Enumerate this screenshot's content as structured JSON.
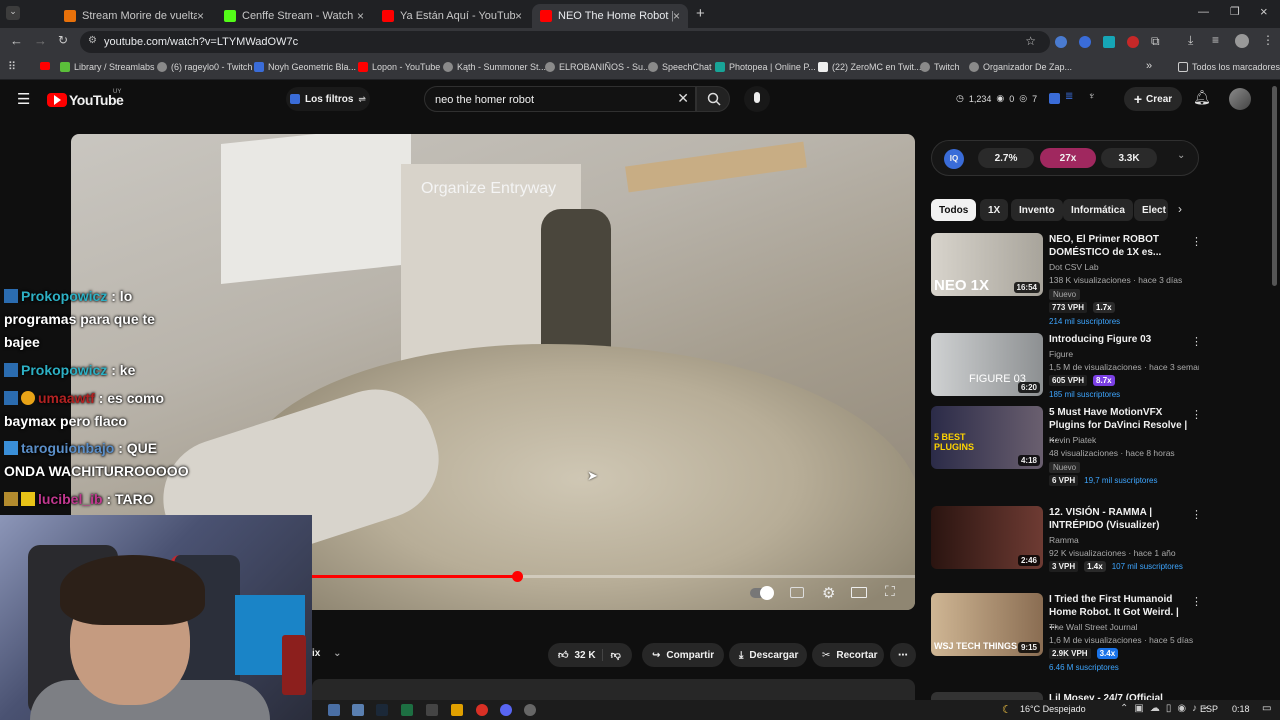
{
  "browser": {
    "tabs": [
      {
        "title": "Stream Morire de vuelta - Cenfe",
        "color": "#e8710a",
        "active": false
      },
      {
        "title": "Cenffe Stream - Watch Live on",
        "color": "#53fc18",
        "active": false
      },
      {
        "title": "Ya Están Aquí - YouTube",
        "color": "#ff0000",
        "active": false
      },
      {
        "title": "NEO The Home Robot | Or",
        "color": "#ff0000",
        "active": true
      }
    ],
    "url": "youtube.com/watch?v=LTYMWadOW7c",
    "bookmarks": [
      "Library / Streamlabs",
      "(6) rageylo0 - Twitch",
      "Noyh Geometric Bla...",
      "Lopon - YouTube",
      "Kąth - Summoner St...",
      "ELROBANIÑOS - Su...",
      "SpeechChat",
      "Photopea | Online P...",
      "(22) ZeroMC en Twit...",
      "Twitch",
      "Organizador De Zap..."
    ],
    "all_bookmarks": "Todos los marcadores"
  },
  "youtube": {
    "logo_text": "YouTube",
    "region": "UY",
    "filters_label": "Los filtros",
    "search_value": "neo the homer robot",
    "header_stats": {
      "views": "1,234",
      "a": "0",
      "b": "7"
    },
    "create_label": "Crear"
  },
  "video": {
    "caption": "Organize Entryway",
    "progress": 0.34
  },
  "actions": {
    "likes": "32 K",
    "share": "Compartir",
    "download": "Descargar",
    "clip": "Recortar",
    "partial": "ix"
  },
  "chat": [
    {
      "user": "Prokopowicz",
      "text": ": lo",
      "cont": "programas para que te",
      "cont2": "bajee",
      "color": "#2db0c4"
    },
    {
      "user": "Prokopowicz",
      "text": ": ke",
      "color": "#2db0c4"
    },
    {
      "user": "umaawtf",
      "text": ": es como",
      "cont": "baymax pero flaco",
      "color": "#b22222"
    },
    {
      "user": "taroguionbajo",
      "text": ": QUE",
      "cont": "ONDA WACHITURROOOOO",
      "color": "#5b8fc9"
    },
    {
      "user": "lucibel_ib",
      "text": ": TARO",
      "color": "#c0388f"
    }
  ],
  "iq": {
    "label": "IQ",
    "a": "2.7%",
    "b": "27x",
    "c": "3.3K"
  },
  "chips": [
    "Todos",
    "1X",
    "Invento",
    "Informática",
    "Elect"
  ],
  "recommendations": [
    {
      "title": "NEO, El Primer ROBOT DOMÉSTICO de 1X es...",
      "channel": "Dot CSV Lab",
      "meta": "138 K visualizaciones · hace 3 días",
      "badge": "Nuevo",
      "vph": "773 VPH",
      "mult": "1.7x",
      "subs": "214 mil suscriptores",
      "duration": "16:54",
      "thumb_text": "NEO 1X",
      "mult_color": "#2a2a2a",
      "thumb_color": "#c7c3ba"
    },
    {
      "title": "Introducing Figure 03",
      "channel": "Figure",
      "meta": "1,5 M de visualizaciones · hace 3 seman...",
      "vph": "605 VPH",
      "mult": "8.7x",
      "subs": "185 mil suscriptores",
      "duration": "6:20",
      "thumb_text": "FIGURE 03",
      "mult_color": "#7b3fe4",
      "thumb_color": "#9a9d9e"
    },
    {
      "title": "5 Must Have MotionVFX Plugins for DaVinci Resolve | ...",
      "channel": "Kevin Piatek",
      "meta": "48 visualizaciones · hace 8 horas",
      "badge": "Nuevo",
      "vph": "6 VPH",
      "subs": "19,7 mil suscriptores",
      "duration": "4:18",
      "thumb_text": "5 BEST PLUGINS",
      "mult_color": "#2a2a2a",
      "thumb_color": "#3b3a52"
    },
    {
      "title": "12. VISIÓN - RAMMA | INTRÉPIDO (Visualizer)",
      "channel": "Ramma",
      "meta": "92 K visualizaciones · hace 1 año",
      "vph": "3 VPH",
      "mult": "1.4x",
      "subs": "107 mil suscriptores",
      "duration": "2:46",
      "thumb_text": "",
      "mult_color": "#2a2a2a",
      "thumb_color": "#3a1f1c"
    },
    {
      "title": "I Tried the First Humanoid Home Robot. It Got Weird. | ...",
      "channel": "The Wall Street Journal",
      "meta": "1,6 M de visualizaciones · hace 5 días",
      "vph": "2.9K VPH",
      "mult": "3.4x",
      "subs": "6.46 M suscriptores",
      "duration": "9:15",
      "thumb_text": "WSJ TECH THINGS",
      "mult_color": "#1a73e8",
      "thumb_color": "#b59a7a"
    },
    {
      "title": "Lil Mosey - 24/7 (Official Music...",
      "channel": "",
      "meta": "",
      "vph": "",
      "subs": "",
      "duration": "",
      "thumb_text": "",
      "mult_color": "#2a2a2a",
      "thumb_color": "#333"
    }
  ],
  "taskbar": {
    "weather": "16°C Despejado",
    "lang": "ESP",
    "time": "0:18"
  }
}
